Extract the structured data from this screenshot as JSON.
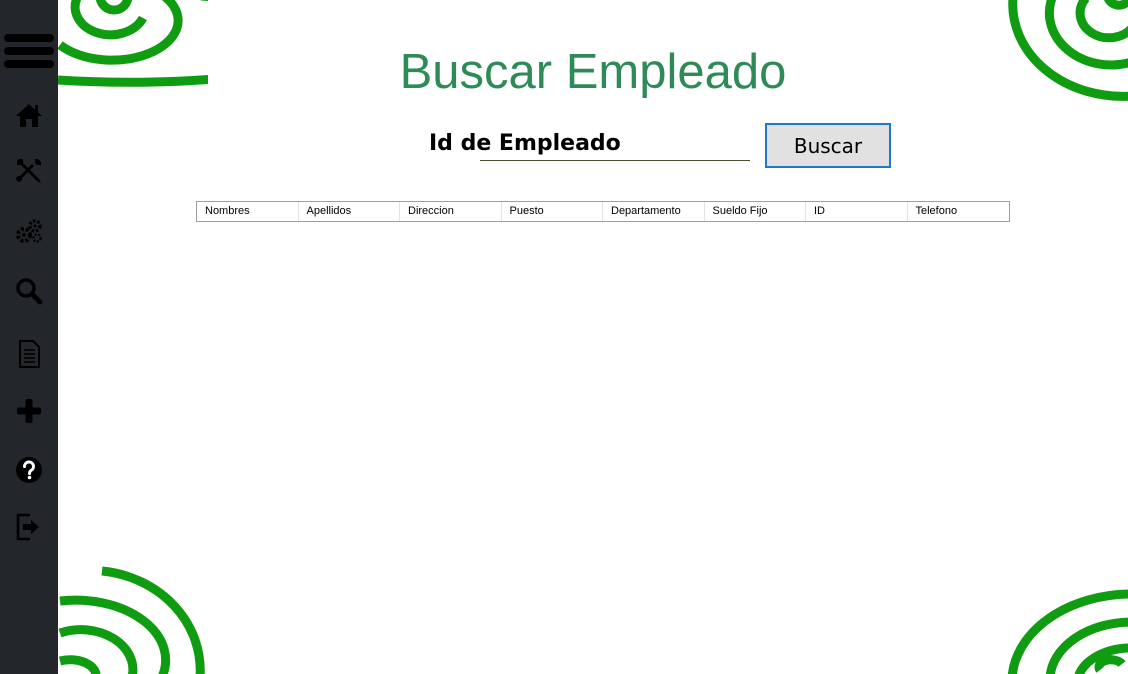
{
  "page": {
    "title": "Buscar Empleado"
  },
  "search": {
    "label": "Id de Empleado",
    "value": "",
    "button_label": "Buscar"
  },
  "table": {
    "columns": [
      "Nombres",
      "Apellidos",
      "Direccion",
      "Puesto",
      "Departamento",
      "Sueldo Fijo",
      "ID",
      "Telefono"
    ]
  },
  "sidebar": {
    "items": [
      "menu-icon",
      "home-icon",
      "tools-icon",
      "gears-icon",
      "search-icon",
      "document-icon",
      "plus-icon",
      "help-icon",
      "logout-icon"
    ]
  },
  "colors": {
    "sidebar_bg": "#23272b",
    "title": "#2e8b57",
    "decoration": "#109c10",
    "button_border": "#1e78cc"
  }
}
